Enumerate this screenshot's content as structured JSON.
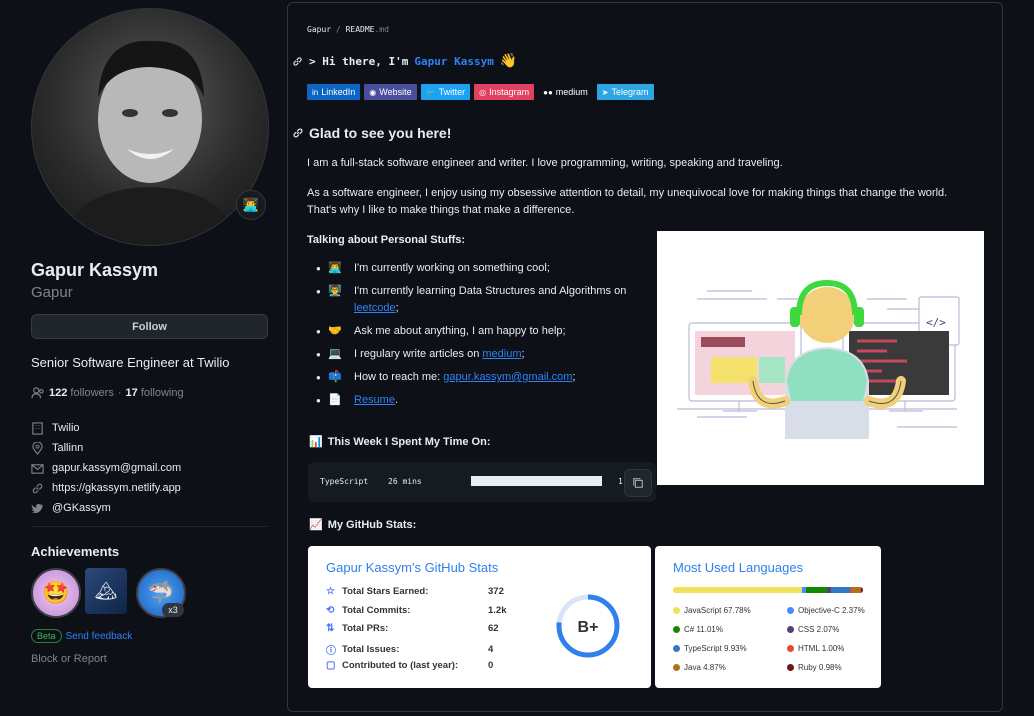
{
  "profile": {
    "name": "Gapur Kassym",
    "login": "Gapur",
    "follow_label": "Follow",
    "bio": "Senior Software Engineer at Twilio",
    "followers_count": "122",
    "followers_label": "followers",
    "dot": "·",
    "following_count": "17",
    "following_label": "following",
    "company": "Twilio",
    "location": "Tallinn",
    "email": "gapur.kassym@gmail.com",
    "website": "https://gkassym.netlify.app",
    "twitter": "@GKassym",
    "status_emoji": "👨‍💻"
  },
  "achievements": {
    "title": "Achievements",
    "multiplier": "x3",
    "beta": "Beta",
    "feedback": "Send feedback"
  },
  "block_label": "Block or Report",
  "readme": {
    "crumb_user": "Gapur",
    "crumb_sep": "/",
    "crumb_file": "README",
    "crumb_ext": ".md",
    "greeting": "> Hi there, I'm",
    "greeting_name": "Gapur Kassym",
    "wave": "👋",
    "shields": [
      {
        "label": "LinkedIn",
        "color": "#0a66c2",
        "icon": "in"
      },
      {
        "label": "Website",
        "color": "#4a4e9c",
        "icon": "◉"
      },
      {
        "label": "Twitter",
        "color": "#1da1f2",
        "icon": "🐦"
      },
      {
        "label": "Instagram",
        "color": "#e4405f",
        "icon": "◎"
      },
      {
        "label": "medium",
        "color": "#0d1117",
        "icon": "●●"
      },
      {
        "label": "Telegram",
        "color": "#2ca5e0",
        "icon": "➤"
      }
    ],
    "heading": "Glad to see you here!",
    "para1": "I am a full-stack software engineer and writer. I love programming, writing, speaking and traveling.",
    "para2a": "As a software engineer, I enjoy using my obsessive attention to detail, my unequivocal love for making things that change the world.",
    "para2b": "That's why I like to make things that make a difference.",
    "talking": "Talking about Personal Stuffs:",
    "items": [
      {
        "emoji": "👨‍💻",
        "text": "I'm currently working on something cool;"
      },
      {
        "emoji": "👨‍🏫",
        "text": "I'm currently learning Data Structures and Algorithms on",
        "link": "leetcode",
        "after": ";"
      },
      {
        "emoji": "🤝",
        "text": "Ask me about anything, I am happy to help;"
      },
      {
        "emoji": "💻",
        "text": "I regulary write articles on",
        "link": "medium",
        "after": ";"
      },
      {
        "emoji": "📫",
        "text": "How to reach me:",
        "link": "gapur.kassym@gmail.com",
        "after": ";"
      },
      {
        "emoji": "📄",
        "text": "",
        "link": "Resume",
        "after": "."
      }
    ],
    "week_icon": "📊",
    "week_title": "This Week I Spent My Time On:",
    "code_lang": "TypeScript",
    "code_time": "26 mins",
    "code_pct": "1",
    "stats_icon": "📈",
    "stats_title": "My GitHub Stats:"
  },
  "stats_card": {
    "title": "Gapur Kassym's GitHub Stats",
    "rank": "B+",
    "rows": [
      {
        "icon": "☆",
        "label": "Total Stars Earned:",
        "value": "372"
      },
      {
        "icon": "⟲",
        "label": "Total Commits:",
        "value": "1.2k"
      },
      {
        "icon": "⇅",
        "label": "Total PRs:",
        "value": "62"
      },
      {
        "icon": "ⓘ",
        "label": "Total Issues:",
        "value": "4"
      },
      {
        "icon": "▢",
        "label": "Contributed to (last year):",
        "value": "0"
      }
    ]
  },
  "lang_card": {
    "title": "Most Used Languages",
    "langs": [
      {
        "name": "JavaScript",
        "pct": "67.78%",
        "color": "#f1e05a"
      },
      {
        "name": "Objective-C",
        "pct": "2.37%",
        "color": "#438eff"
      },
      {
        "name": "C#",
        "pct": "11.01%",
        "color": "#178600"
      },
      {
        "name": "CSS",
        "pct": "2.07%",
        "color": "#563d7c"
      },
      {
        "name": "TypeScript",
        "pct": "9.93%",
        "color": "#3178c6"
      },
      {
        "name": "HTML",
        "pct": "1.00%",
        "color": "#e34c26"
      },
      {
        "name": "Java",
        "pct": "4.87%",
        "color": "#b07219"
      },
      {
        "name": "Ruby",
        "pct": "0.98%",
        "color": "#701516"
      }
    ]
  }
}
